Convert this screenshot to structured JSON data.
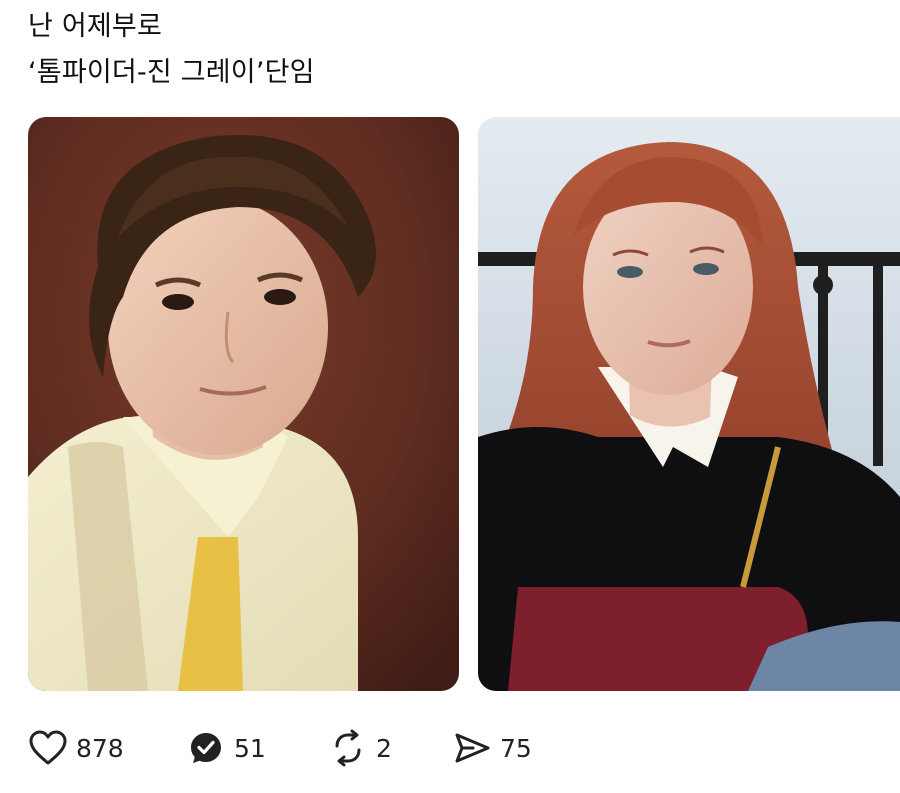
{
  "post": {
    "text_line1": "난 어제부로",
    "text_line2": "‘톰파이더-진 그레이’단임"
  },
  "media": [
    {
      "subject": "young man with curly brown hair, pale yellow collared cardigan, brown backdrop"
    },
    {
      "subject": "young woman with long auburn hair, black top with white collar, burgundy bag"
    }
  ],
  "actions": {
    "like": {
      "icon": "heart-icon",
      "count": "878"
    },
    "reply": {
      "icon": "reply-badge-icon",
      "count": "51"
    },
    "repost": {
      "icon": "repost-icon",
      "count": "2"
    },
    "share": {
      "icon": "send-icon",
      "count": "75"
    }
  },
  "colors": {
    "text": "#111111",
    "icon": "#222222",
    "left_backdrop": "#5a2a1e",
    "right_sky": "#cfd9e3"
  }
}
